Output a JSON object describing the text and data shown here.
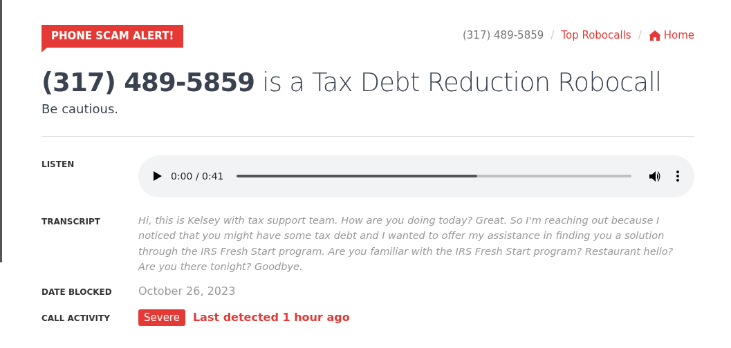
{
  "alert_badge": "PHONE SCAM ALERT!",
  "breadcrumb_separator": "/",
  "breadcrumb": [
    {
      "label": "(317) 489-5859",
      "kind": "current"
    },
    {
      "label": "Top Robocalls",
      "kind": "link"
    },
    {
      "label": "Home",
      "kind": "home"
    }
  ],
  "heading": "**(317) 489-5859** is a Tax Debt Reduction Robocall",
  "subheading": "Be cautious.",
  "details": [
    {
      "label": "LISTEN",
      "kind": "audio",
      "time": "0:00 / 0:41",
      "level": 0.61
    },
    {
      "label": "TRANSCRIPT",
      "kind": "transcript",
      "value": "Hi, this is Kelsey with tax support team. How are you doing today? Great. So I'm reaching out because I noticed that you might have some tax debt and I wanted to offer my assistance in finding you a solution through the IRS Fresh Start program. Are you familiar with the IRS Fresh Start program? Restaurant hello? Are you there tonight? Goodbye."
    },
    {
      "label": "DATE BLOCKED",
      "kind": "date",
      "value": "October 26, 2023"
    },
    {
      "label": "CALL ACTIVITY",
      "kind": "activity",
      "badge": "Severe",
      "value": "Last detected 1 hour ago"
    }
  ]
}
